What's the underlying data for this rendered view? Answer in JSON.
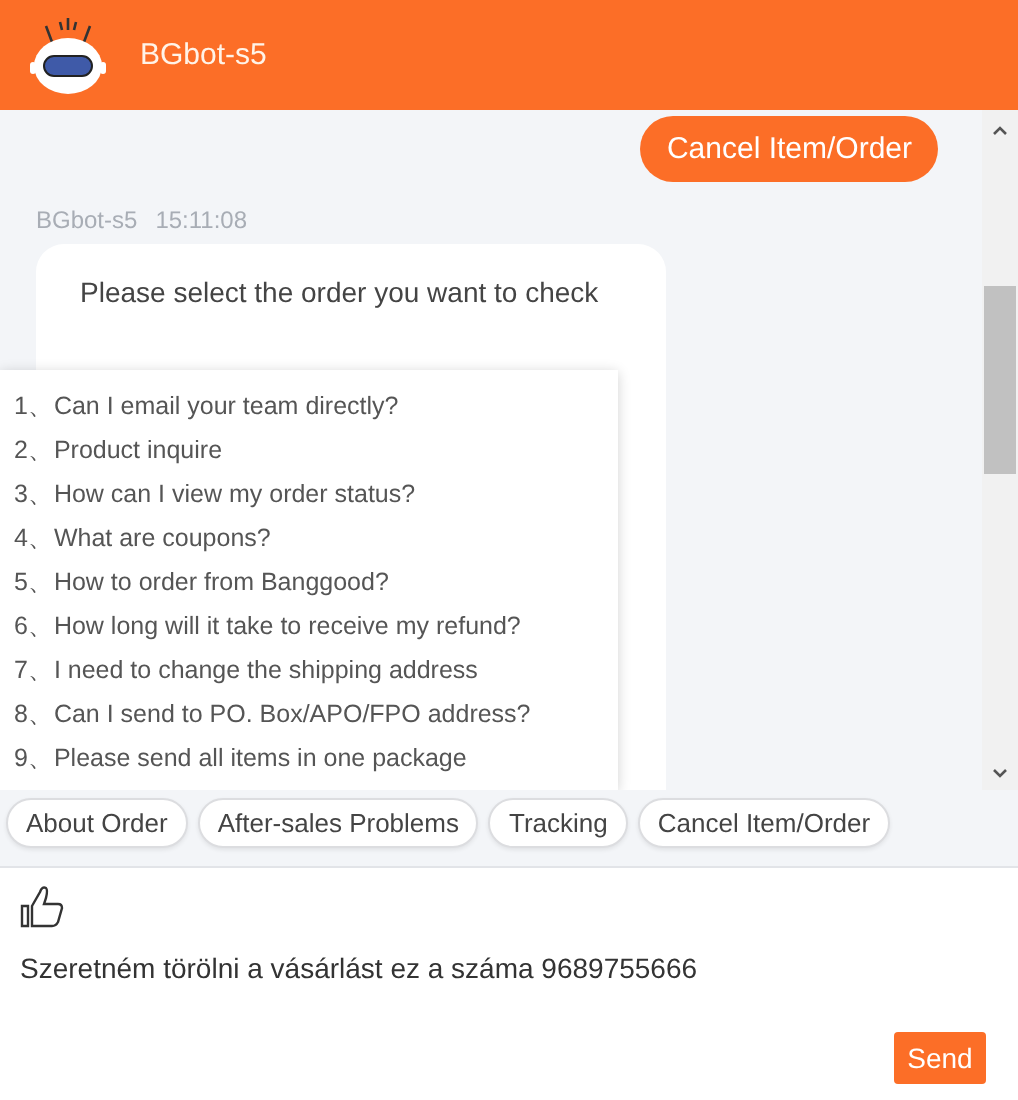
{
  "header": {
    "bot_name": "BGbot-s5"
  },
  "messages": [
    {
      "kind": "user",
      "text": "Cancel Item/Order"
    },
    {
      "kind": "bot",
      "sender": "BGbot-s5",
      "time": "15:11:08",
      "text": "Please select the order you want to check"
    }
  ],
  "suggestions": [
    "1、Can I email your team directly?",
    "2、Product inquire",
    "3、How can I view my order status?",
    "4、What are coupons?",
    "5、How to order from Banggood?",
    "6、How long will it take to receive my refund?",
    "7、I need to change the shipping address",
    "8、Can I send to PO. Box/APO/FPO address?",
    "9、Please send all items in one package"
  ],
  "quick_replies": [
    "About Order",
    "After-sales Problems",
    "Tracking",
    "Cancel Item/Order"
  ],
  "composer": {
    "value": "Szeretném törölni a vásárlást ez a száma 9689755666",
    "send_label": "Send"
  }
}
